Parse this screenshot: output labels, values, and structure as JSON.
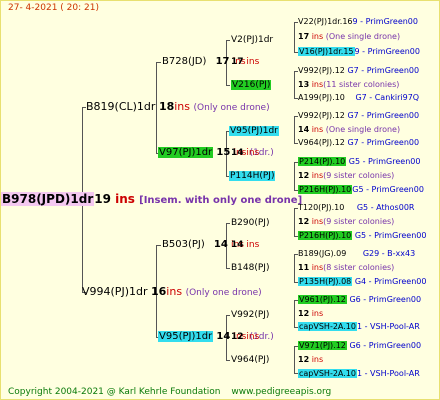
{
  "header": {
    "text": "27-   4-2021  ( 20:  21)"
  },
  "footer": {
    "copyright": "Copyright 2004-2021 @ Karl Kehrle Foundation",
    "site": "www.pedigreeapis.org"
  },
  "subject": {
    "name": "B978(JPD)1dr",
    "num": "19",
    "ins": "ins",
    "note": "[Insem. with only one drone]"
  },
  "gen1": {
    "upper": {
      "name": "B819(CL)1dr",
      "num": "18",
      "ins": "ins",
      "note": "(Only one drone)"
    },
    "lower": {
      "name": "V994(PJ)1dr",
      "num": "16",
      "ins": "ins",
      "note": "(Only one drone)"
    }
  },
  "gen2": {
    "a": {
      "name": "B728(JD)",
      "num": "17",
      "ins": "ins"
    },
    "b": {
      "name": "V97(PJ)1dr",
      "num": "15",
      "ins": "ins",
      "note": "(1dr.)"
    },
    "c": {
      "name": "B503(PJ)",
      "num": "14",
      "ins": "ins"
    },
    "d": {
      "name": "V95(PJ)1dr",
      "num": "14",
      "ins": "ins",
      "note": "(1dr.)"
    }
  },
  "gen3": {
    "a": {
      "name": "V2(PJ)1dr",
      "num": "17",
      "ins": "ins"
    },
    "b": {
      "name": "V216(PJ)",
      "num": "",
      "ins": ""
    },
    "c": {
      "name": "V95(PJ)1dr",
      "num": "14",
      "ins": "ins"
    },
    "d": {
      "name": "P114H(PJ)",
      "num": "",
      "ins": ""
    },
    "e": {
      "name": "B290(PJ)",
      "num": "14",
      "ins": "ins"
    },
    "f": {
      "name": "B148(PJ)",
      "num": "",
      "ins": ""
    },
    "g": {
      "name": "V992(PJ)",
      "num": "12",
      "ins": "ins"
    },
    "h": {
      "name": "V964(PJ)",
      "num": "12",
      "ins": "ins"
    }
  },
  "gen4": {
    "r1": {
      "name": "V22(PJ)1dr.16",
      "info": "9 - PrimGreen00"
    },
    "r2": {
      "num": "17",
      "ins": "ins",
      "note": "(One single drone)"
    },
    "r3": {
      "name": "V16(PJ)1dr.15",
      "info": "9 - PrimGreen00"
    },
    "r4": {
      "name": "V992(PJ).12",
      "info": "G7 - PrimGreen00"
    },
    "r5": {
      "num": "13",
      "ins": "ins",
      "note": "(11 sister colonies)"
    },
    "r6": {
      "name": "A199(PJ).10",
      "info": "G7 - Cankiri97Q"
    },
    "r7": {
      "name": "V992(PJ).12",
      "info": "G7 - PrimGreen00"
    },
    "r8": {
      "num": "14",
      "ins": "ins",
      "note": "(One single drone)"
    },
    "r9": {
      "name": "V964(PJ).12",
      "info": "G7 - PrimGreen00"
    },
    "r10": {
      "name": "P214(PJ).10",
      "info": "G5 - PrimGreen00"
    },
    "r11": {
      "num": "12",
      "ins": "ins",
      "note": "(9 sister colonies)"
    },
    "r12": {
      "name": "P216H(PJ).10",
      "info": "G5 - PrimGreen00"
    },
    "r13": {
      "name": "T120(PJ).10",
      "info": "G5 - Athos00R"
    },
    "r14": {
      "num": "12",
      "ins": "ins",
      "note": "(9 sister colonies)"
    },
    "r15": {
      "name": "P216H(PJ).10",
      "info": "G5 - PrimGreen00"
    },
    "r16": {
      "name": "B189(JG).09",
      "info": "G29 - B-xx43"
    },
    "r17": {
      "num": "11",
      "ins": "ins",
      "note": "(8 sister colonies)"
    },
    "r18": {
      "name": "P135H(PJ).08",
      "info": "G4 - PrimGreen00"
    },
    "r19": {
      "name": "V961(PJ).12",
      "info": "G6 - PrimGreen00"
    },
    "r20": {
      "num": "12",
      "ins": "ins",
      "note": ""
    },
    "r21": {
      "name": "capVSH-2A.10",
      "info": "1 - VSH-Pool-AR"
    },
    "r22": {
      "name": "V971(PJ).12",
      "info": "G6 - PrimGreen00"
    },
    "r23": {
      "num": "12",
      "ins": "ins",
      "note": ""
    },
    "r24": {
      "name": "capVSH-2A.10",
      "info": "1 - VSH-Pool-AR"
    }
  }
}
